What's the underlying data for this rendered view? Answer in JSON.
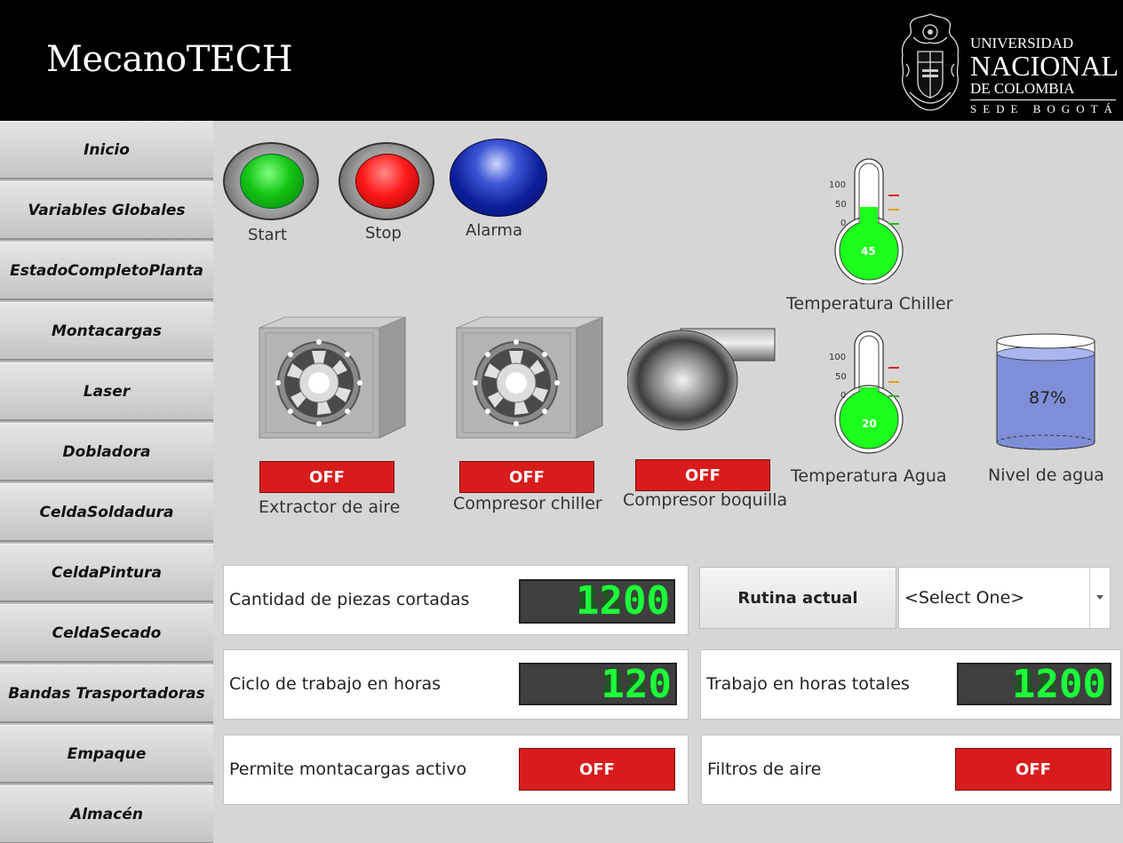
{
  "header": {
    "brand": "MecanoTECH",
    "university": {
      "line1": "UNIVERSIDAD",
      "line2": "NACIONAL",
      "line3": "DE COLOMBIA",
      "line4": "SEDE BOGOTÁ"
    }
  },
  "sidebar": {
    "items": [
      {
        "label": "Inicio"
      },
      {
        "label": "Variables Globales"
      },
      {
        "label": "EstadoCompletoPlanta"
      },
      {
        "label": "Montacargas"
      },
      {
        "label": "Laser"
      },
      {
        "label": "Dobladora"
      },
      {
        "label": "CeldaSoldadura"
      },
      {
        "label": "CeldaPintura"
      },
      {
        "label": "CeldaSecado"
      },
      {
        "label": "Bandas Trasportadoras"
      },
      {
        "label": "Empaque"
      },
      {
        "label": "Almacén"
      }
    ]
  },
  "indicators": {
    "start": {
      "label": "Start",
      "color": "#14c414"
    },
    "stop": {
      "label": "Stop",
      "color": "#ff1a1a"
    },
    "alarm": {
      "label": "Alarma",
      "color": "#0b1f9a"
    }
  },
  "thermometers": {
    "chiller": {
      "label": "Temperatura Chiller",
      "value": 45,
      "scale": [
        "100",
        "50",
        "0"
      ],
      "reading": "45"
    },
    "agua": {
      "label": "Temperatura Agua",
      "value": 20,
      "scale": [
        "100",
        "50",
        "0"
      ],
      "reading": "20"
    }
  },
  "tank": {
    "label": "Nivel de agua",
    "value": 87,
    "reading": "87%"
  },
  "equipment": {
    "extractor": {
      "label": "Extractor de aire",
      "state": "OFF"
    },
    "compresor_chiller": {
      "label": "Compresor chiller",
      "state": "OFF"
    },
    "compresor_boquilla": {
      "label": "Compresor boquilla",
      "state": "OFF"
    }
  },
  "panels": {
    "piezas": {
      "label": "Cantidad de piezas cortadas",
      "display": "1200",
      "ghost": "8888"
    },
    "ciclo": {
      "label": "Ciclo de trabajo en horas",
      "display": "120",
      "ghost": "888"
    },
    "horas_totales": {
      "label": "Trabajo en horas totales",
      "display": "1200",
      "ghost": "8888"
    },
    "montacargas": {
      "label": "Permite montacargas activo",
      "state": "OFF"
    },
    "filtros": {
      "label": "Filtros de aire",
      "state": "OFF"
    }
  },
  "rutina": {
    "label": "Rutina actual",
    "selected": "<Select One>"
  },
  "colors": {
    "off": "#d81c1c",
    "lcd_on": "#1cff3a",
    "fill": "#1cff1c"
  }
}
